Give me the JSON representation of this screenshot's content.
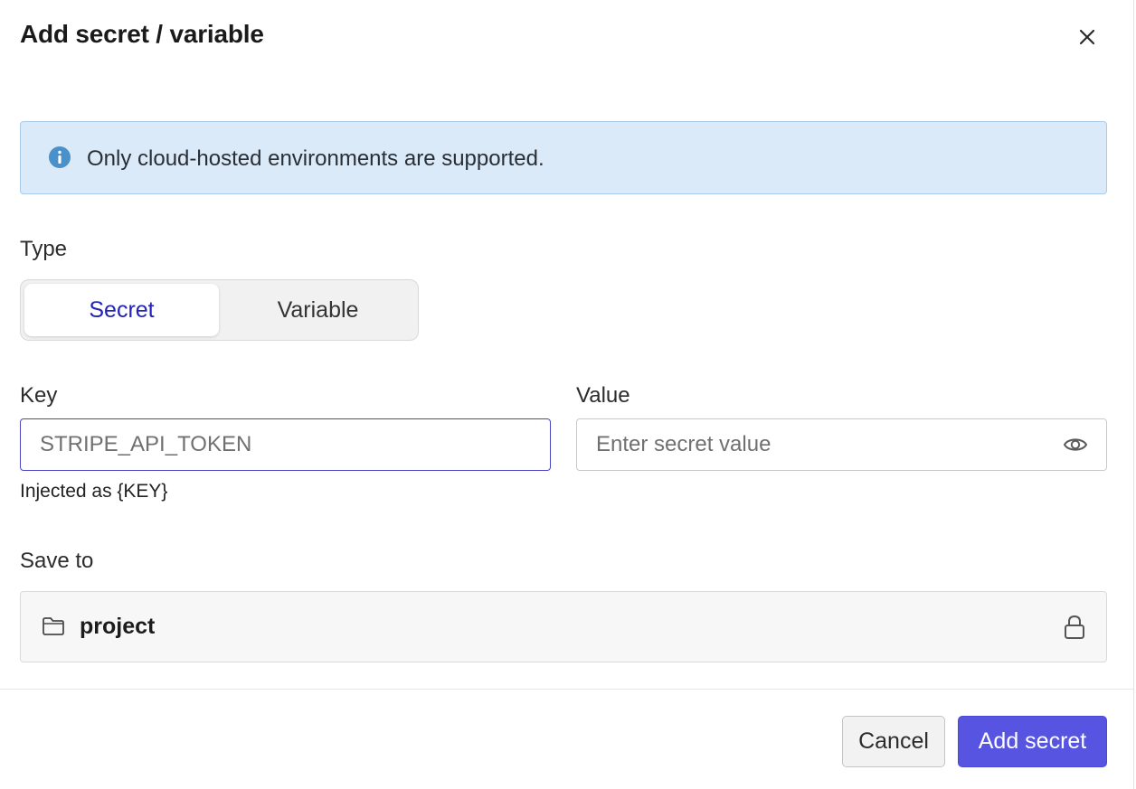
{
  "dialog": {
    "title": "Add secret / variable",
    "close_icon": "close-icon"
  },
  "banner": {
    "icon": "info-icon",
    "text": "Only cloud-hosted environments are supported.",
    "accent": "#4a90c9"
  },
  "type": {
    "label": "Type",
    "options": [
      "Secret",
      "Variable"
    ],
    "selected": "Secret"
  },
  "key": {
    "label": "Key",
    "value": "",
    "placeholder": "STRIPE_API_TOKEN",
    "hint": "Injected as {KEY}"
  },
  "value": {
    "label": "Value",
    "value": "",
    "placeholder": "Enter secret value",
    "toggle_icon": "eye-icon"
  },
  "save_to": {
    "label": "Save to",
    "icon": "folder-icon",
    "value": "project",
    "lock_icon": "lock-icon"
  },
  "footer": {
    "cancel_label": "Cancel",
    "submit_label": "Add secret",
    "primary_color": "#5654e0"
  }
}
